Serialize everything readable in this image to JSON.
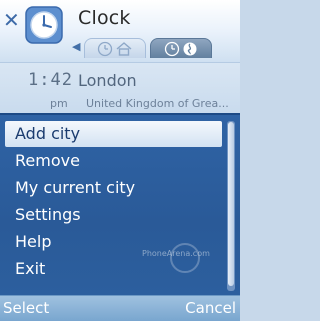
{
  "titlebar": {
    "close_icon": "close-icon",
    "app_icon": "clock-icon",
    "title": "Clock",
    "tabs": [
      {
        "icon": "home-clock-icon",
        "active": false
      },
      {
        "icon": "world-clock-icon",
        "active": true
      }
    ]
  },
  "clock": {
    "time": "1:42",
    "ampm": "pm",
    "city": "London",
    "country": "United Kingdom of Grea..."
  },
  "menu": {
    "items": [
      {
        "label": "Add city",
        "highlighted": true
      },
      {
        "label": "Remove",
        "highlighted": false
      },
      {
        "label": "My current city",
        "highlighted": false
      },
      {
        "label": "Settings",
        "highlighted": false
      },
      {
        "label": "Help",
        "highlighted": false
      },
      {
        "label": "Exit",
        "highlighted": false
      }
    ]
  },
  "watermark": "PhoneArena.com",
  "softkeys": {
    "left": "Select",
    "right": "Cancel"
  },
  "colors": {
    "menu_background": "#2f63a5",
    "highlight": "#e6eef8",
    "softkey_bar": "#8db4da"
  }
}
